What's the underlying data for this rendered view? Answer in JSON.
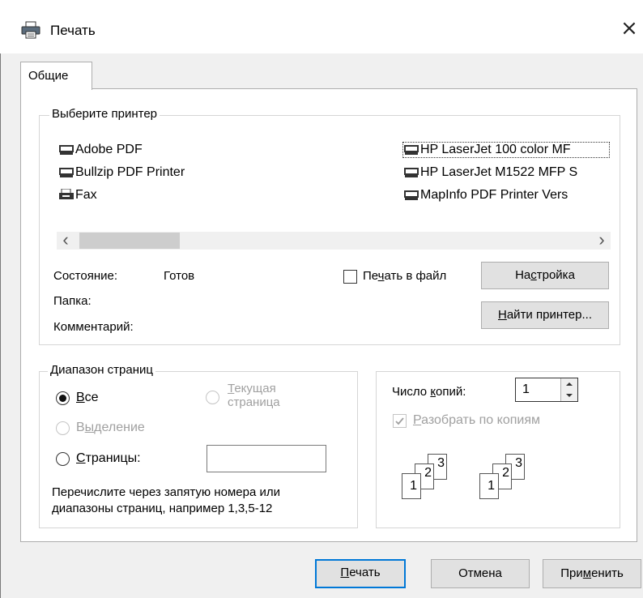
{
  "window": {
    "title": "Печать",
    "close_glyph": "×"
  },
  "tabs": [
    {
      "label": "Общие"
    }
  ],
  "printer_group": {
    "legend": "Выберите принтер",
    "printers": [
      {
        "name": "Adobe PDF",
        "icon": "printer-icon"
      },
      {
        "name": "Bullzip PDF Printer",
        "icon": "printer-icon"
      },
      {
        "name": "Fax",
        "icon": "fax-icon"
      },
      {
        "name": "HP LaserJet 100 color MF",
        "icon": "printer-icon",
        "selected": true
      },
      {
        "name": "HP LaserJet M1522 MFP S",
        "icon": "printer-icon"
      },
      {
        "name": "MapInfo PDF Printer Vers",
        "icon": "printer-icon"
      }
    ],
    "scroll_left": "‹",
    "scroll_right": "›",
    "status_label": "Состояние:",
    "status_value": "Готов",
    "folder_label": "Папка:",
    "comment_label": "Комментарий:",
    "print_to_file": {
      "pre": "Пе",
      "key": "ч",
      "post": "ать в файл",
      "checked": false
    },
    "settings_btn": {
      "pre": "На",
      "key": "с",
      "post": "тройка"
    },
    "find_btn": {
      "pre": "",
      "key": "Н",
      "post": "айти принтер..."
    }
  },
  "range_group": {
    "legend": "Диапазон страниц",
    "all": {
      "pre": "",
      "key": "В",
      "post": "се",
      "checked": true
    },
    "selection": {
      "pre": "В",
      "key": "ы",
      "post": "деление",
      "disabled": true
    },
    "current_line1": {
      "pre": "",
      "key": "Т",
      "post": "екущая"
    },
    "current_line2": "страница",
    "pages": {
      "pre": "",
      "key": "С",
      "post": "траницы:"
    },
    "pages_value": "",
    "hint_line1": "Перечислите через запятую номера или",
    "hint_line2": "диапазоны страниц, например 1,3,5-12"
  },
  "copies_group": {
    "copies_label": {
      "pre": "Число ",
      "key": "к",
      "post": "опий:"
    },
    "copies_value": "1",
    "collate": {
      "pre": "",
      "key": "Р",
      "post": "азобрать по копиям",
      "checked": true,
      "disabled": true
    },
    "collate_digits": [
      "1",
      "2",
      "3"
    ]
  },
  "footer": {
    "print_btn": {
      "pre": "",
      "key": "П",
      "post": "ечать"
    },
    "cancel_btn": "Отмена",
    "apply_btn": {
      "pre": "При",
      "key": "м",
      "post": "енить"
    }
  },
  "colors": {
    "accent": "#0078d7",
    "disabled": "#a0a0a0"
  }
}
